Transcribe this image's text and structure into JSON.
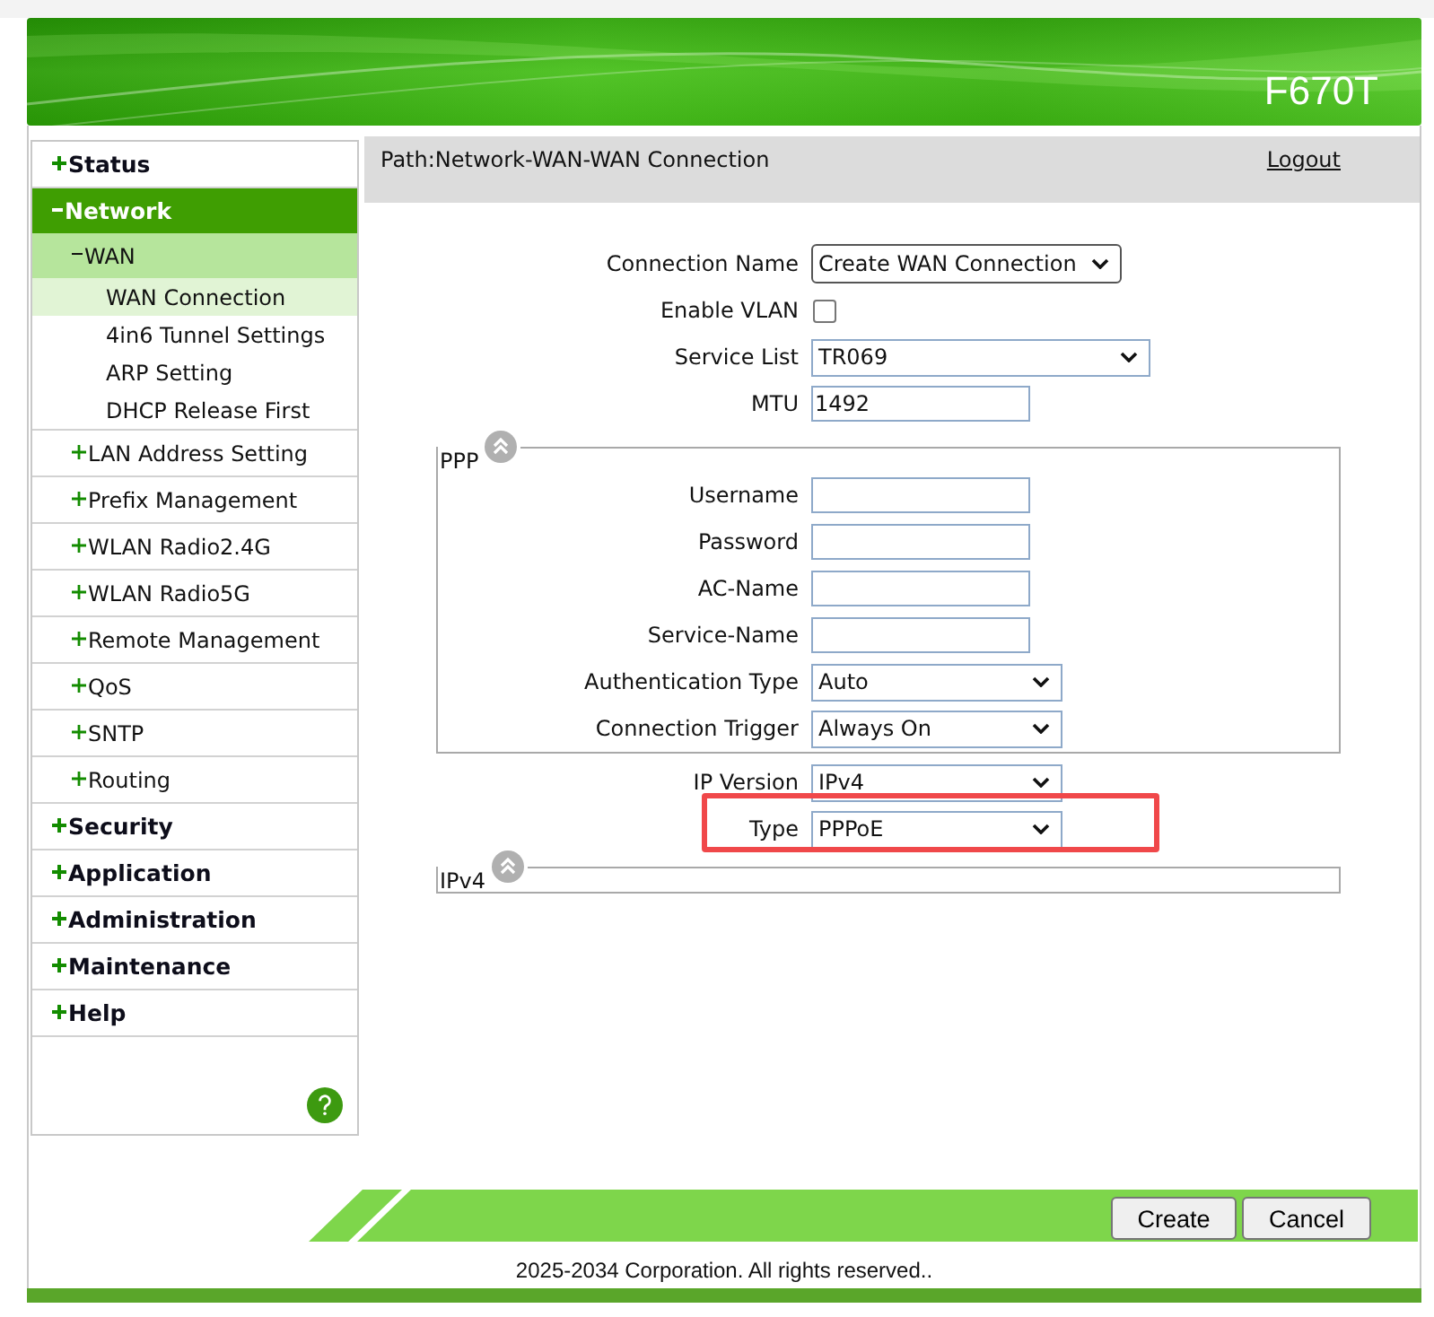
{
  "header": {
    "model": "F670T"
  },
  "sidebar": {
    "items": [
      {
        "label": "Status",
        "expanded": false,
        "selected": false
      },
      {
        "label": "Network",
        "expanded": true,
        "selected": true,
        "children": [
          {
            "label": "WAN",
            "expanded": true,
            "selected": true,
            "children": [
              {
                "label": "WAN Connection",
                "selected": true
              },
              {
                "label": "4in6 Tunnel Settings",
                "selected": false
              },
              {
                "label": "ARP Setting",
                "selected": false
              },
              {
                "label": "DHCP Release First",
                "selected": false
              }
            ]
          },
          {
            "label": "LAN Address Setting",
            "expanded": false,
            "selected": false
          },
          {
            "label": "Prefix Management",
            "expanded": false,
            "selected": false
          },
          {
            "label": "WLAN Radio2.4G",
            "expanded": false,
            "selected": false
          },
          {
            "label": "WLAN Radio5G",
            "expanded": false,
            "selected": false
          },
          {
            "label": "Remote Management",
            "expanded": false,
            "selected": false
          },
          {
            "label": "QoS",
            "expanded": false,
            "selected": false
          },
          {
            "label": "SNTP",
            "expanded": false,
            "selected": false
          },
          {
            "label": "Routing",
            "expanded": false,
            "selected": false
          }
        ]
      },
      {
        "label": "Security",
        "expanded": false,
        "selected": false
      },
      {
        "label": "Application",
        "expanded": false,
        "selected": false
      },
      {
        "label": "Administration",
        "expanded": false,
        "selected": false
      },
      {
        "label": "Maintenance",
        "expanded": false,
        "selected": false
      },
      {
        "label": "Help",
        "expanded": false,
        "selected": false
      }
    ]
  },
  "path_bar": {
    "path": "Path:Network-WAN-WAN Connection",
    "logout": "Logout"
  },
  "form": {
    "rows": [
      {
        "kind": "select",
        "label": "Connection Name",
        "value": "Create WAN Connection"
      },
      {
        "kind": "checkbox",
        "label": "Enable VLAN",
        "checked": false
      },
      {
        "kind": "select",
        "label": "Service List",
        "value": "TR069"
      },
      {
        "kind": "text",
        "label": "MTU",
        "value": "1492"
      }
    ]
  },
  "ppp": {
    "legend": "PPP",
    "rows": [
      {
        "kind": "text",
        "label": "Username"
      },
      {
        "kind": "text",
        "label": "Password"
      },
      {
        "kind": "text",
        "label": "AC-Name"
      },
      {
        "kind": "text",
        "label": "Service-Name"
      },
      {
        "kind": "select",
        "label": "Authentication Type",
        "value": "Auto"
      },
      {
        "kind": "select",
        "label": "Connection Trigger",
        "value": "Always On"
      }
    ]
  },
  "ip": {
    "rows": [
      {
        "kind": "select",
        "label": "IP Version",
        "value": "IPv4",
        "highlighted": false
      },
      {
        "kind": "select",
        "label": "Type",
        "value": "PPPoE",
        "highlighted": true
      }
    ]
  },
  "ipv4": {
    "legend": "IPv4"
  },
  "buttons": [
    {
      "label": "Create"
    },
    {
      "label": "Cancel"
    }
  ],
  "footer": {
    "copyright": "2025-2034 Corporation. All rights reserved.."
  }
}
